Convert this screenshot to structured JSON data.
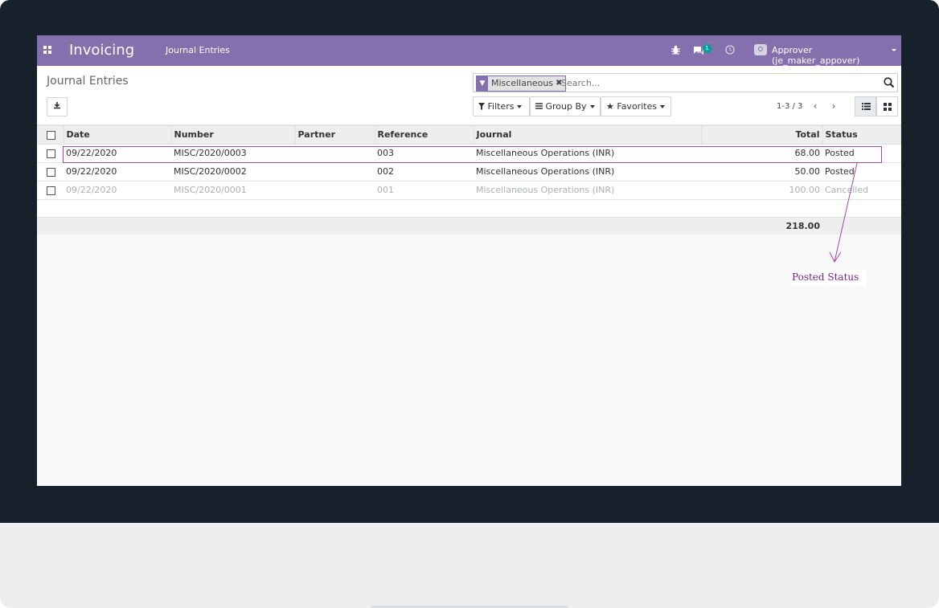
{
  "navbar": {
    "app_title": "Invoicing",
    "menu_item": "Journal Entries",
    "messages_count": "1",
    "user_label": "Approver (je_maker_appover)",
    "icons": [
      "apps-icon",
      "bug-icon",
      "chat-icon",
      "clock-icon",
      "avatar-icon"
    ],
    "bg_color": "#8470ad"
  },
  "control_panel": {
    "breadcrumb": "Journal Entries",
    "search": {
      "facet_value": "Miscellaneous",
      "placeholder": "Search..."
    },
    "filters_label": "Filters",
    "groupby_label": "Group By",
    "favorites_label": "Favorites",
    "pager": "1-3 / 3"
  },
  "table": {
    "columns": [
      "Date",
      "Number",
      "Partner",
      "Reference",
      "Journal",
      "Total",
      "Status"
    ],
    "rows": [
      {
        "date": "09/22/2020",
        "number": "MISC/2020/0003",
        "partner": "",
        "reference": "003",
        "journal": "Miscellaneous Operations (INR)",
        "total": "68.00",
        "status": "Posted"
      },
      {
        "date": "09/22/2020",
        "number": "MISC/2020/0002",
        "partner": "",
        "reference": "002",
        "journal": "Miscellaneous Operations (INR)",
        "total": "50.00",
        "status": "Posted"
      },
      {
        "date": "09/22/2020",
        "number": "MISC/2020/0001",
        "partner": "",
        "reference": "001",
        "journal": "Miscellaneous Operations (INR)",
        "total": "100.00",
        "status": "Cancelled"
      }
    ],
    "footer_total": "218.00"
  },
  "annotation": {
    "label": "Posted  Status",
    "color": "#a04aa4"
  }
}
